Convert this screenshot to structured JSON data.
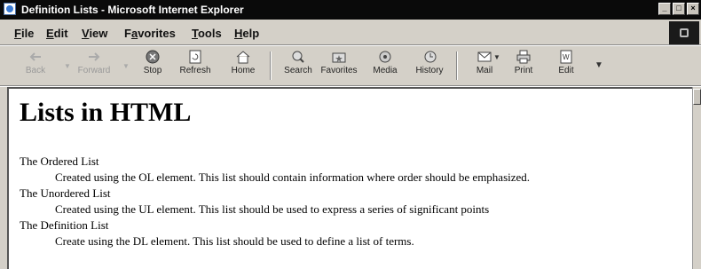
{
  "window": {
    "title": "Definition Lists - Microsoft Internet Explorer"
  },
  "menu": [
    {
      "label": "File",
      "u": "F",
      "rest": "ile"
    },
    {
      "label": "Edit",
      "u": "E",
      "rest": "dit"
    },
    {
      "label": "View",
      "u": "V",
      "rest": "iew"
    },
    {
      "label": "Favorites",
      "pre": "F",
      "u": "a",
      "rest": "vorites"
    },
    {
      "label": "Tools",
      "u": "T",
      "rest": "ools"
    },
    {
      "label": "Help",
      "u": "H",
      "rest": "elp"
    }
  ],
  "toolbar": {
    "back": "Back",
    "forward": "Forward",
    "stop": "Stop",
    "refresh": "Refresh",
    "home": "Home",
    "search": "Search",
    "favorites": "Favorites",
    "media": "Media",
    "history": "History",
    "mail": "Mail",
    "print": "Print",
    "edit": "Edit"
  },
  "page": {
    "heading": "Lists in HTML",
    "items": [
      {
        "term": "The Ordered List",
        "definition": "Created using the OL element. This list should contain information where order should be emphasized."
      },
      {
        "term": "The Unordered List",
        "definition": "Created using the UL element. This list should be used to express a series of significant points"
      },
      {
        "term": "The Definition List",
        "definition": "Create using the DL element. This list should be used to define a list of terms."
      }
    ]
  },
  "colors": {
    "titlebar": "#0a0a0a",
    "chrome": "#d4d0c8",
    "content_bg": "#ffffff"
  }
}
